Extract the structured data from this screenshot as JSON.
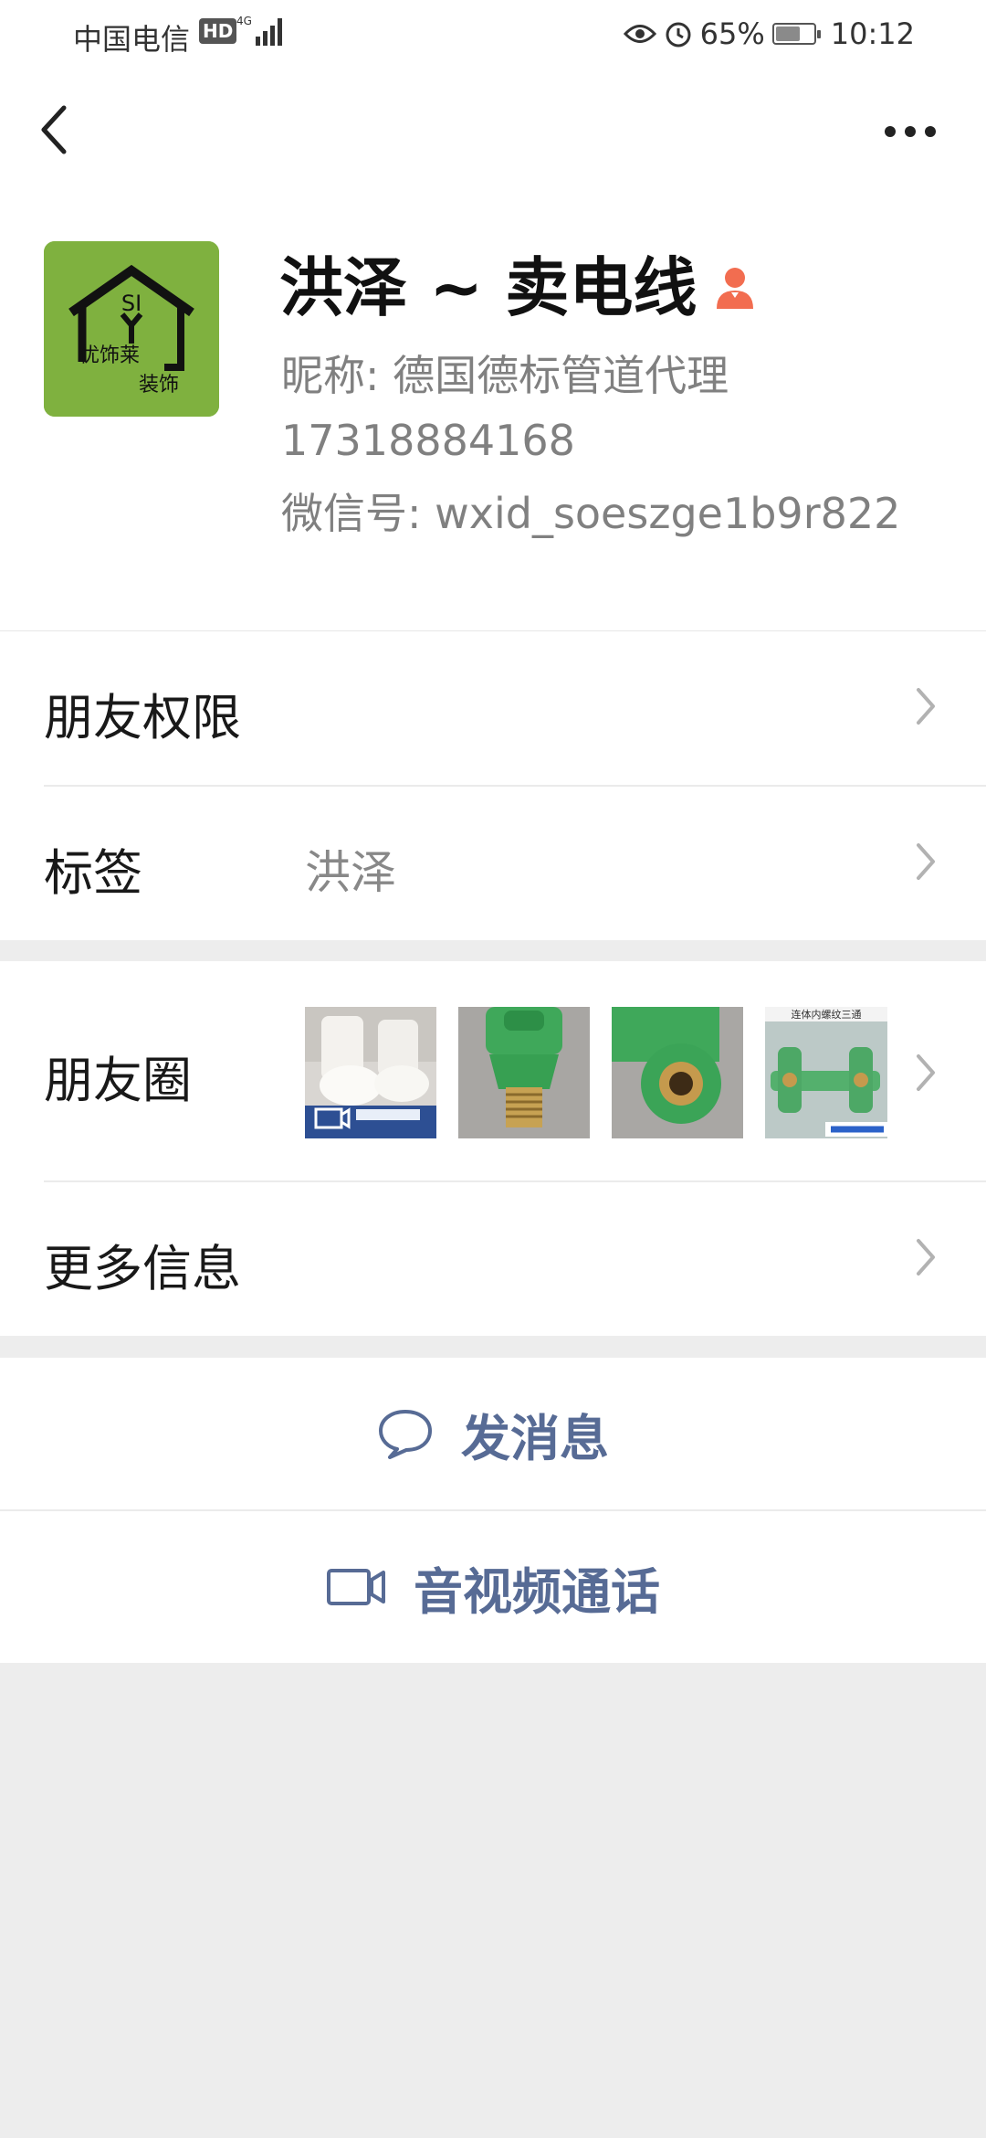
{
  "status_bar": {
    "carrier": "中国电信",
    "hd_badge": "HD",
    "network": "4G",
    "battery_percent": "65%",
    "battery_level": 0.65,
    "time": "10:12",
    "icons": [
      "eye-icon",
      "alarm-icon",
      "battery-icon"
    ]
  },
  "nav": {
    "back_icon": "chevron-left-icon",
    "more_icon": "more-dots-icon"
  },
  "profile": {
    "name": "洪泽 ~ 卖电线",
    "gender_icon": "female-user-icon",
    "nickname": "昵称: 德国德标管道代理",
    "phone": "17318884168",
    "wechat_id": "微信号: wxid_soeszge1b9r822",
    "avatar_text": {
      "logo": "SI",
      "line1": "优饰莱",
      "line2": "装饰"
    }
  },
  "rows": {
    "friend_permissions": "朋友权限",
    "tags_label": "标签",
    "tags_value": "洪泽",
    "moments_label": "朋友圈",
    "more_info": "更多信息"
  },
  "moments_thumbs": [
    {
      "name": "toilet-video-thumb",
      "has_video": true
    },
    {
      "name": "green-fitting-thumb-1",
      "has_video": false
    },
    {
      "name": "green-fitting-thumb-2",
      "has_video": false
    },
    {
      "name": "green-tee-fitting-thumb",
      "has_video": false,
      "caption": "连体内螺纹三通"
    }
  ],
  "actions": {
    "send_message": "发消息",
    "video_call": "音视频通话"
  },
  "colors": {
    "accent_link": "#576b95",
    "background": "#ededed",
    "gender_icon": "#f26d50",
    "avatar_bg": "#7fb13f"
  }
}
